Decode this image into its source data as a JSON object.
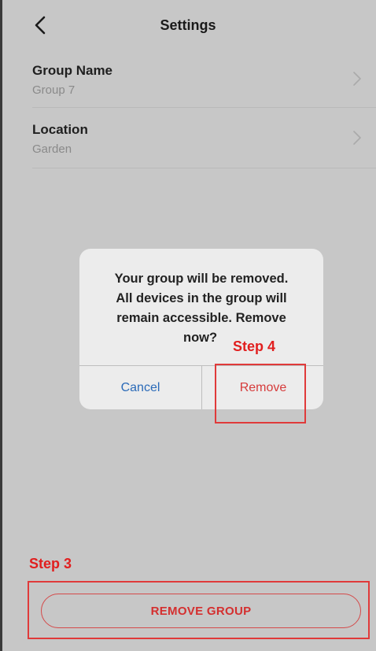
{
  "header": {
    "title": "Settings"
  },
  "settings": {
    "rows": [
      {
        "label": "Group Name",
        "value": "Group 7"
      },
      {
        "label": "Location",
        "value": "Garden"
      }
    ]
  },
  "dialog": {
    "message_line1": "Your group will be removed.",
    "message_line2": "All devices in the group will",
    "message_line3": "remain accessible. Remove",
    "message_line4": "now?",
    "cancel_label": "Cancel",
    "remove_label": "Remove"
  },
  "annotations": {
    "step4": "Step 4",
    "step3": "Step 3"
  },
  "footer": {
    "remove_group_label": "REMOVE GROUP"
  },
  "colors": {
    "background": "#c7c7c7",
    "dialog": "#ececec",
    "accent_red": "#e11f1f",
    "cancel_blue": "#2a6ab8"
  }
}
